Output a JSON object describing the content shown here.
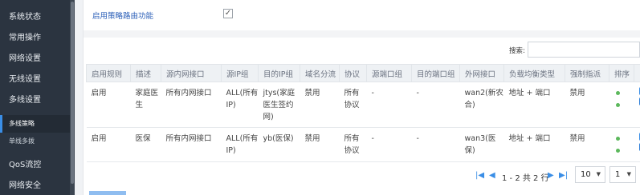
{
  "sidebar": {
    "items": [
      {
        "label": "系统状态"
      },
      {
        "label": "常用操作"
      },
      {
        "label": "网络设置"
      },
      {
        "label": "无线设置"
      },
      {
        "label": "多线设置"
      }
    ],
    "subitems": [
      {
        "label": "多线策略",
        "active": true
      },
      {
        "label": "单线多拨",
        "active": false
      }
    ],
    "bottom_items": [
      {
        "label": "QoS流控"
      },
      {
        "label": "网络安全"
      }
    ]
  },
  "feature": {
    "label": "启用策略路由功能",
    "checked_glyph": "✓"
  },
  "search": {
    "label": "搜索:",
    "value": ""
  },
  "table": {
    "headers": [
      "启用规则",
      "描述",
      "源内网接口",
      "源IP组",
      "目的IP组",
      "域名分流",
      "协议",
      "源端口组",
      "目的端口组",
      "外网接口",
      "负载均衡类型",
      "强制指派",
      "排序",
      ""
    ],
    "rows": [
      {
        "enabled": "启用",
        "desc": "家庭医生",
        "src_iface": "所有内网接口",
        "src_ip": "ALL(所有IP)",
        "dst_ip": "jtys(家庭医生签约网)",
        "domain": "禁用",
        "protocol": "所有协议",
        "src_port": "-",
        "dst_port": "-",
        "wan": "wan2(新农合)",
        "lb_type": "地址 + 端口",
        "force": "禁用"
      },
      {
        "enabled": "启用",
        "desc": "医保",
        "src_iface": "所有内网接口",
        "src_ip": "ALL(所有IP)",
        "dst_ip": "yb(医保)",
        "domain": "禁用",
        "protocol": "所有协议",
        "src_port": "-",
        "dst_port": "-",
        "wan": "wan3(医保)",
        "lb_type": "地址 + 端口",
        "force": "禁用"
      }
    ]
  },
  "pagination": {
    "info": "1 - 2 共 2 行",
    "page_size": "10",
    "page": "1",
    "icons": [
      "first-page-icon",
      "prev-page-icon",
      "next-page-icon",
      "last-page-icon"
    ]
  },
  "colors": {
    "sidebar_bg": "#2b3440",
    "accent": "#3a8ee6",
    "link": "#2b5fb8",
    "status_green": "#5cb85c"
  }
}
